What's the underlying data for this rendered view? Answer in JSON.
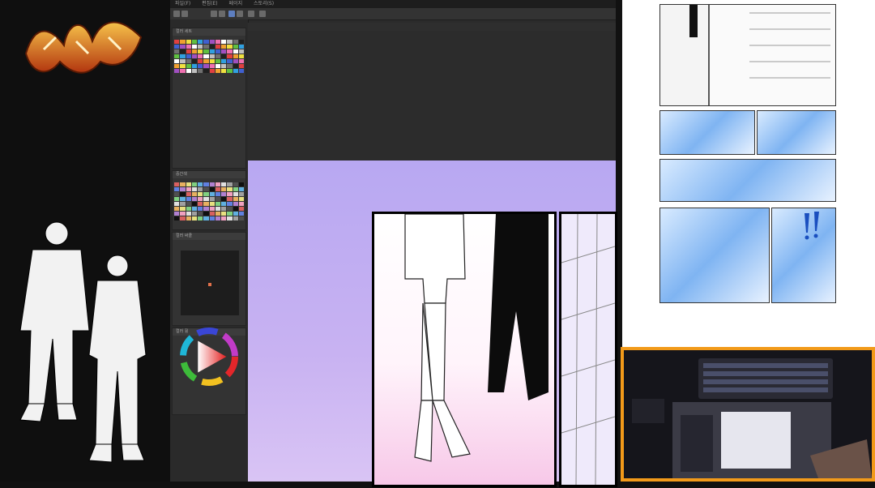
{
  "app": {
    "menu_items": [
      "파일(F)",
      "편집(E)",
      "페이지",
      "스토리(S)"
    ],
    "panel_titles": {
      "palette_top": "컬러 세트",
      "palette_mid": "중간색",
      "color_map": "컬러 써클",
      "color_wheel": "컬러 휠"
    }
  },
  "colors": {
    "frame_orange": "#f29a1a",
    "canvas_purple": "#c8b2f2",
    "logo_orange": "#e8731c"
  },
  "icons": [
    "brush-icon",
    "eraser-icon",
    "hand-icon",
    "zoom-icon",
    "color-wheel-icon"
  ]
}
